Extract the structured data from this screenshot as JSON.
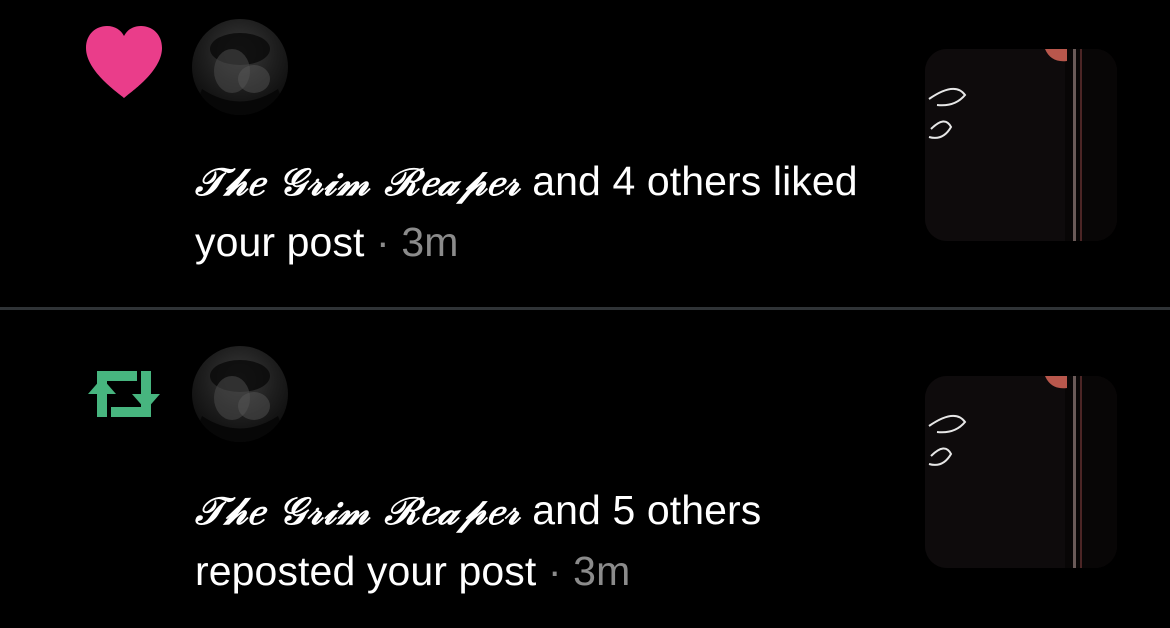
{
  "notifications": [
    {
      "type": "like",
      "icon": "heart-icon",
      "icon_color": "#ea3d8a",
      "avatar_icon": "avatar",
      "actor": "𝒯𝒽𝑒 𝒢𝓇𝒾𝓂 ℛ𝑒𝒶𝓅𝑒𝓇",
      "actor_plain": "The Grim Reaper",
      "message": "and 4 others liked your post",
      "separator": "·",
      "time": "3m"
    },
    {
      "type": "repost",
      "icon": "repost-icon",
      "icon_color": "#47b57f",
      "avatar_icon": "avatar",
      "actor": "𝒯𝒽𝑒 𝒢𝓇𝒾𝓂 ℛ𝑒𝒶𝓅𝑒𝓇",
      "actor_plain": "The Grim Reaper",
      "message": "and 5 others reposted your post",
      "separator": "·",
      "time": "3m"
    }
  ],
  "colors": {
    "background": "#000000",
    "divider": "#2f3336",
    "text": "#ffffff",
    "muted": "#8b8b8b"
  }
}
